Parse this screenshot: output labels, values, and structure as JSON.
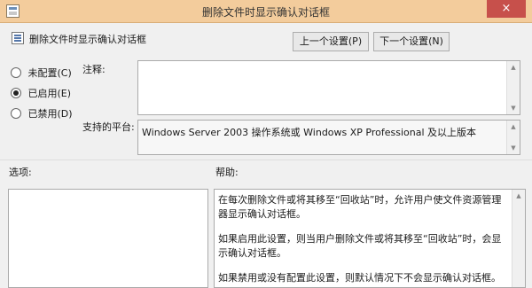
{
  "window": {
    "title": "删除文件时显示确认对话框",
    "close_symbol": "×",
    "app_icon": "policy-icon"
  },
  "header": {
    "title": "删除文件时显示确认对话框",
    "prev_button": "上一个设置(P)",
    "next_button": "下一个设置(N)"
  },
  "state": {
    "options": [
      {
        "label": "未配置(C)",
        "checked": false
      },
      {
        "label": "已启用(E)",
        "checked": true
      },
      {
        "label": "已禁用(D)",
        "checked": false
      }
    ]
  },
  "comment": {
    "label": "注释:",
    "value": ""
  },
  "platform": {
    "label": "支持的平台:",
    "value": "Windows Server 2003 操作系统或 Windows XP Professional 及以上版本"
  },
  "options_panel": {
    "label": "选项:"
  },
  "help_panel": {
    "label": "帮助:",
    "paragraphs": [
      "在每次删除文件或将其移至“回收站”时，允许用户使文件资源管理器显示确认对话框。",
      "如果启用此设置，则当用户删除文件或将其移至“回收站”时，会显示确认对话框。",
      "如果禁用或没有配置此设置，则默认情况下不会显示确认对话框。"
    ]
  }
}
